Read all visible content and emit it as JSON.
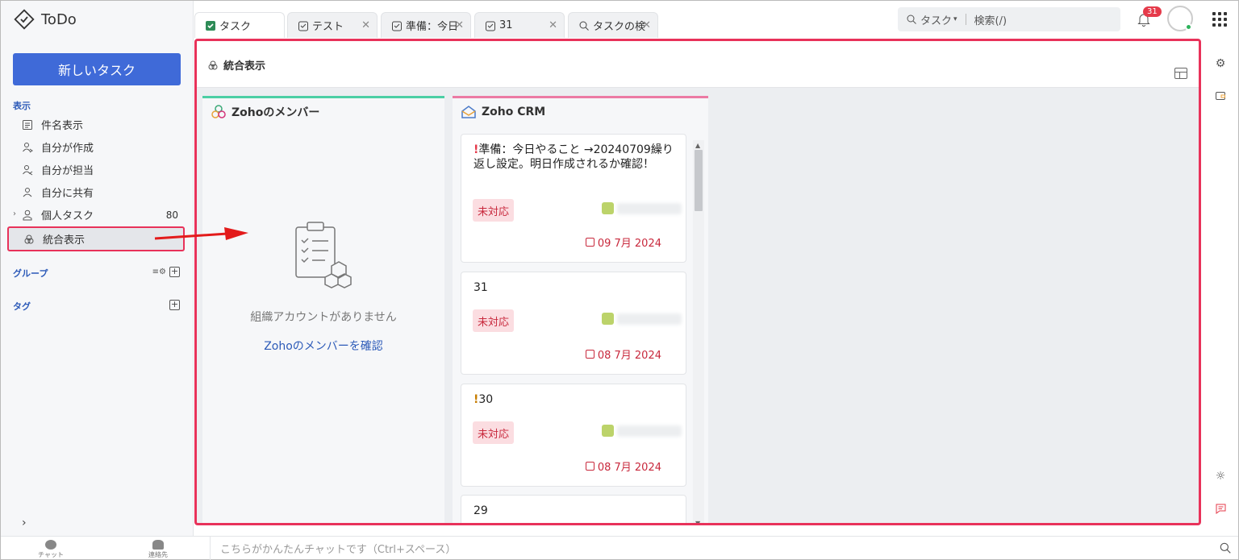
{
  "app": {
    "name": "ToDo"
  },
  "sidebar": {
    "new_task_label": "新しいタスク",
    "section_view": "表示",
    "items": [
      {
        "label": "件名表示",
        "icon": "list-icon"
      },
      {
        "label": "自分が作成",
        "icon": "user-created-icon"
      },
      {
        "label": "自分が担当",
        "icon": "user-assigned-icon"
      },
      {
        "label": "自分に共有",
        "icon": "user-shared-icon"
      },
      {
        "label": "個人タスク",
        "icon": "person-icon",
        "count": "80"
      },
      {
        "label": "統合表示",
        "icon": "unified-icon",
        "active": true
      }
    ],
    "section_group": "グループ",
    "section_tag": "タグ"
  },
  "tabs": [
    {
      "label": "タスク",
      "active": true
    },
    {
      "label": "テスト"
    },
    {
      "label": "準備：今日"
    },
    {
      "label": "31"
    },
    {
      "label": "タスクの検"
    }
  ],
  "search": {
    "scope": "タスク",
    "placeholder": "検索(/)"
  },
  "notifications": {
    "count": "31"
  },
  "main": {
    "title": "統合表示",
    "columns": [
      {
        "title": "Zohoのメンバー",
        "empty_text": "組織アカウントがありません",
        "empty_link": "Zohoのメンバーを確認"
      },
      {
        "title": "Zoho CRM",
        "cards": [
          {
            "bang": "!",
            "title": "準備：今日やること →20240709繰り返し設定。明日作成されるか確認！",
            "status": "未対応",
            "due": "09 7月 2024"
          },
          {
            "bang": "",
            "title": "31",
            "status": "未対応",
            "due": "08 7月 2024"
          },
          {
            "bang": "!",
            "title": "30",
            "status": "未対応",
            "due": "08 7月 2024"
          },
          {
            "bang": "",
            "title": "29"
          }
        ]
      }
    ]
  },
  "bottom": {
    "chat_label": "チャット",
    "contacts_label": "連絡先",
    "chat_placeholder": "こちらがかんたんチャットです（Ctrl+スペース）"
  },
  "colors": {
    "accent": "#3f6ad8",
    "highlight": "#e8325a",
    "status_bg": "#fbdde1"
  }
}
